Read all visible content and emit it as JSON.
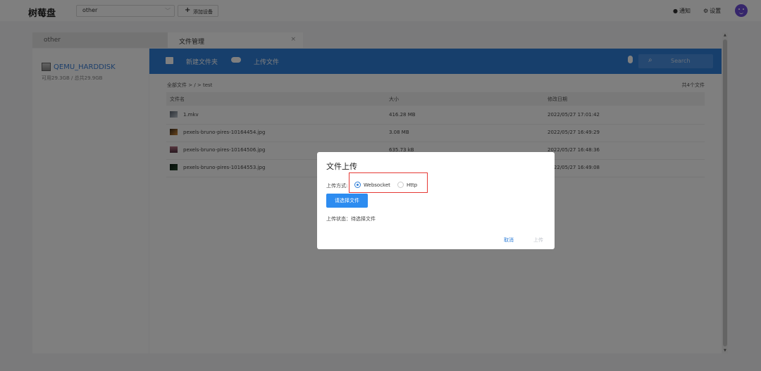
{
  "topbar": {
    "logo": "树莓盘",
    "device_selected": "other",
    "add_device_label": "添加设备",
    "notify_label": "通知",
    "settings_label": "设置"
  },
  "tabs": {
    "left_label": "other",
    "active_label": "文件管理"
  },
  "sidebar": {
    "disk_name": "QEMU_HARDDISK",
    "disk_info": "可用29.3GB / 总共29.9GB"
  },
  "toolbar": {
    "new_folder_label": "新建文件夹",
    "upload_label": "上传文件",
    "search_placeholder": "Search"
  },
  "files": {
    "breadcrumb": "全部文件 > / > test",
    "count_text": "共4个文件",
    "headers": [
      "文件名",
      "大小",
      "修改日期"
    ],
    "rows": [
      {
        "name": "1.mkv",
        "size": "416.28 MB",
        "date": "2022/05/27 17:01:42"
      },
      {
        "name": "pexels-bruno-pires-10164454.jpg",
        "size": "3.08 MB",
        "date": "2022/05/27 16:49:29"
      },
      {
        "name": "pexels-bruno-pires-10164506.jpg",
        "size": "635.73 kB",
        "date": "2022/05/27 16:48:36"
      },
      {
        "name": "pexels-bruno-pires-10164553.jpg",
        "size": "",
        "date": "2022/05/27 16:49:08"
      }
    ]
  },
  "dialog": {
    "title": "文件上传",
    "method_label": "上传方式:",
    "method_options": [
      "Websocket",
      "Http"
    ],
    "method_selected": "Websocket",
    "choose_button": "请选择文件",
    "status_text": "上传状态：待选择文件",
    "cancel_button": "取消",
    "upload_button": "上传"
  },
  "colors": {
    "toolbar": "#2f7ed8",
    "primary_button": "#2d8cf0",
    "highlight_box": "#e53935",
    "avatar": "#6c4cd6"
  }
}
